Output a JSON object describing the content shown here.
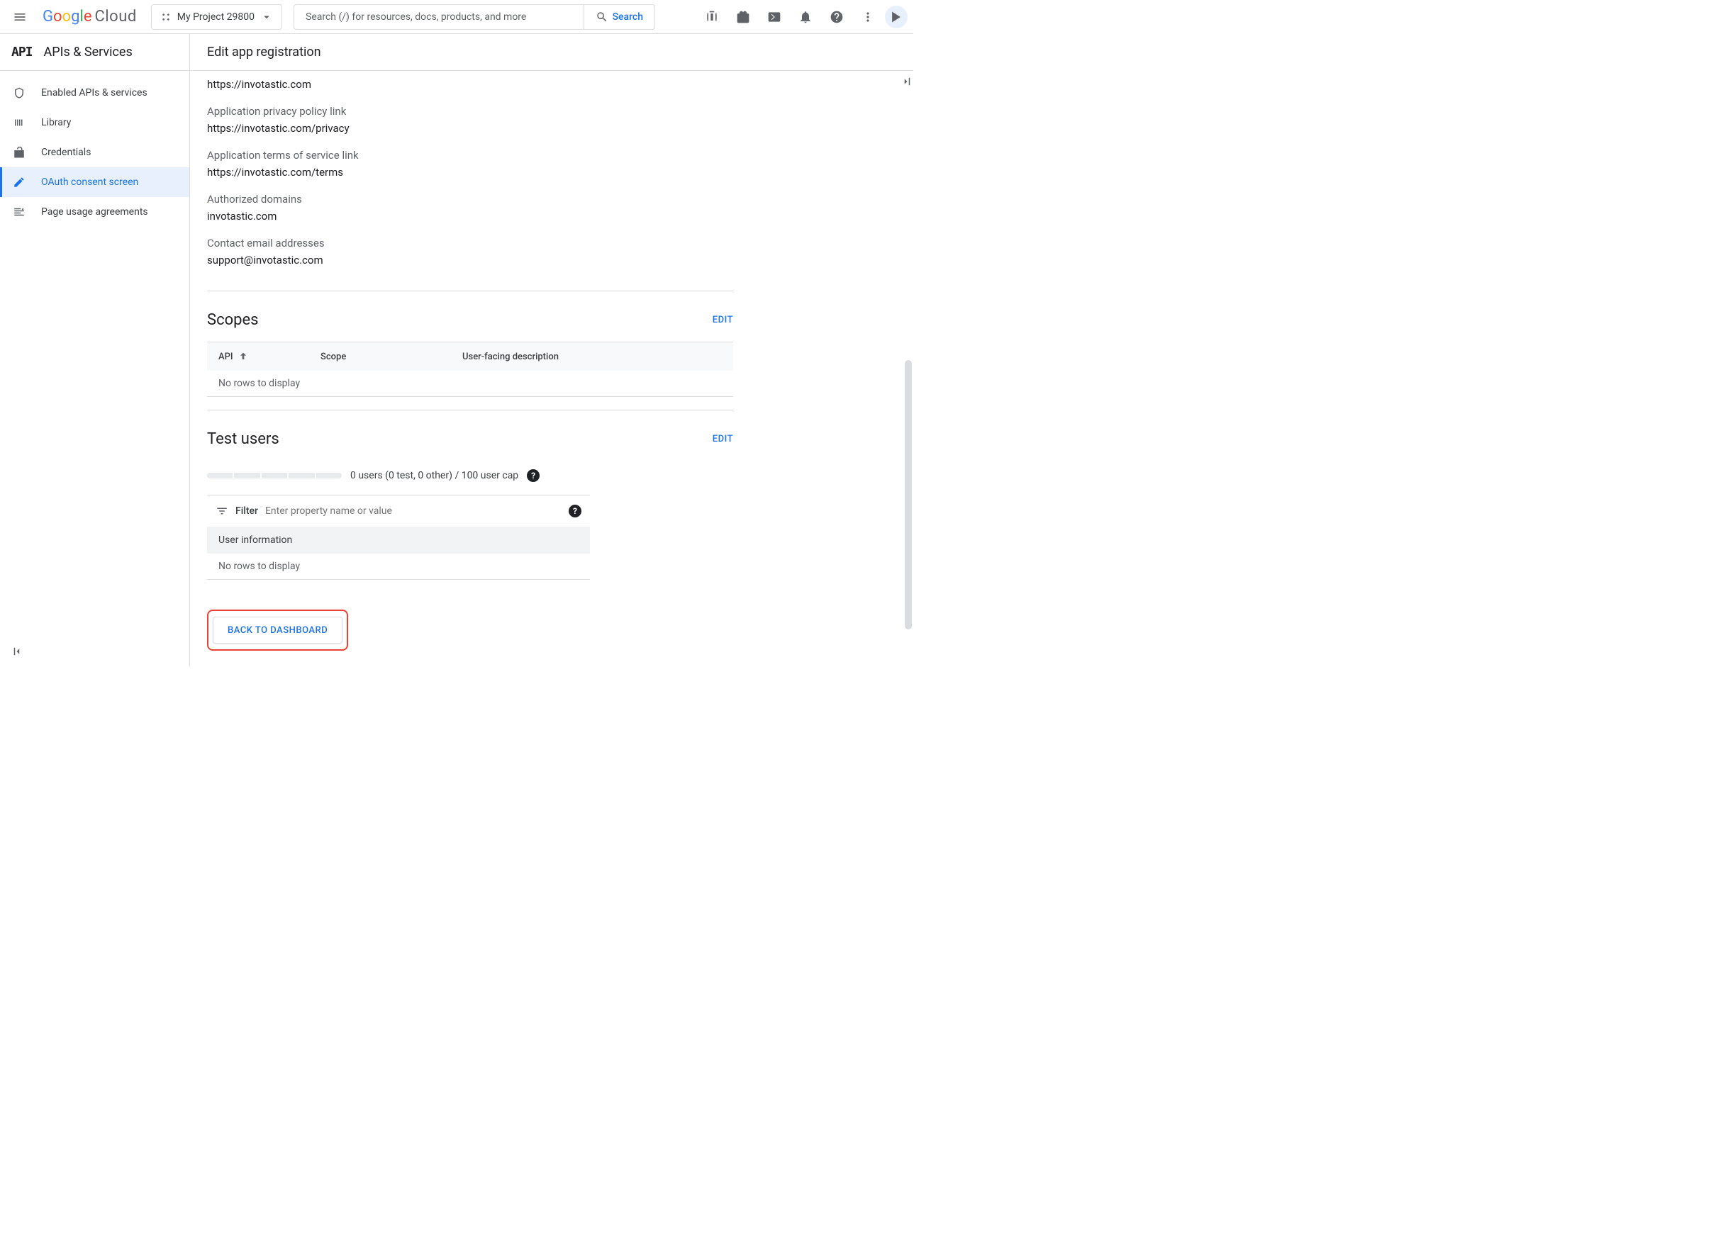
{
  "header": {
    "project_name": "My Project 29800",
    "search_placeholder": "Search (/) for resources, docs, products, and more",
    "search_button": "Search"
  },
  "sidebar": {
    "title": "APIs & Services",
    "items": [
      {
        "label": "Enabled APIs & services"
      },
      {
        "label": "Library"
      },
      {
        "label": "Credentials"
      },
      {
        "label": "OAuth consent screen"
      },
      {
        "label": "Page usage agreements"
      }
    ]
  },
  "page": {
    "title": "Edit app registration",
    "home_link_value": "https://invotastic.com",
    "privacy_label": "Application privacy policy link",
    "privacy_value": "https://invotastic.com/privacy",
    "terms_label": "Application terms of service link",
    "terms_value": "https://invotastic.com/terms",
    "domains_label": "Authorized domains",
    "domains_value": "invotastic.com",
    "contact_label": "Contact email addresses",
    "contact_value": "support@invotastic.com"
  },
  "scopes": {
    "heading": "Scopes",
    "edit": "EDIT",
    "col_api": "API",
    "col_scope": "Scope",
    "col_desc": "User-facing description",
    "empty": "No rows to display"
  },
  "test_users": {
    "heading": "Test users",
    "edit": "EDIT",
    "usage_text": "0 users (0 test, 0 other) / 100 user cap",
    "filter_label": "Filter",
    "filter_placeholder": "Enter property name or value",
    "user_info_col": "User information",
    "empty": "No rows to display"
  },
  "footer": {
    "back_button": "BACK TO DASHBOARD"
  }
}
